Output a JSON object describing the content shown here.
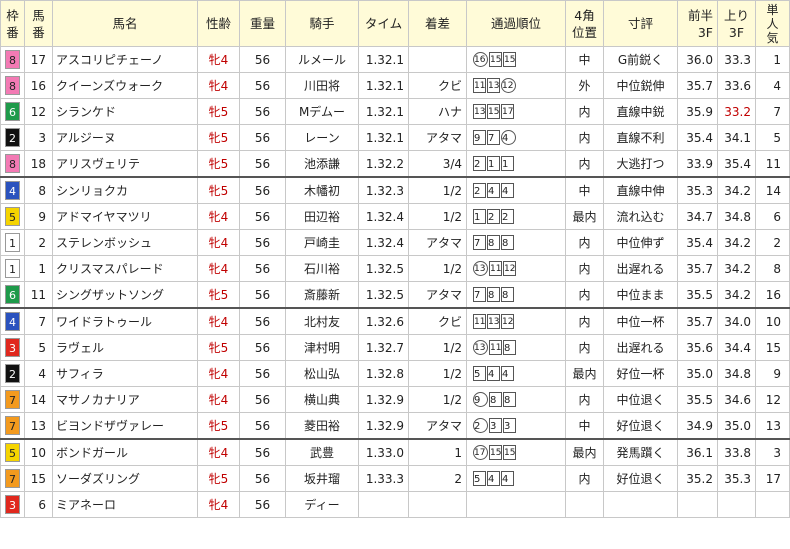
{
  "headers": {
    "waku": [
      "枠",
      "番"
    ],
    "umaban": [
      "馬",
      "番"
    ],
    "name": "馬名",
    "age": "性齢",
    "weight": "重量",
    "jockey": "騎手",
    "time": "タイム",
    "margin": "着差",
    "passing": "通過順位",
    "corner": [
      "4角",
      "位置"
    ],
    "comment": "寸評",
    "first3f": [
      "前半",
      "3F"
    ],
    "last3f": [
      "上り",
      "3F"
    ],
    "pop": [
      "単",
      "人",
      "気"
    ]
  },
  "waku_colors": {
    "1": {
      "bg": "#ffffff",
      "fg": "#222222"
    },
    "2": {
      "bg": "#111111",
      "fg": "#ffffff"
    },
    "3": {
      "bg": "#e0281e",
      "fg": "#ffffff"
    },
    "4": {
      "bg": "#2a52be",
      "fg": "#ffffff"
    },
    "5": {
      "bg": "#f5d400",
      "fg": "#222222"
    },
    "6": {
      "bg": "#1e9a4a",
      "fg": "#ffffff"
    },
    "7": {
      "bg": "#f39a1e",
      "fg": "#222222"
    },
    "8": {
      "bg": "#f37ab4",
      "fg": "#222222"
    }
  },
  "rows": [
    {
      "waku": "8",
      "umaban": "17",
      "name": "アスコリピチェーノ",
      "age": "牝4",
      "weight": "56",
      "jockey": "ルメール",
      "time": "1.32.1",
      "margin": "",
      "passing": [
        {
          "n": "16",
          "c": true
        },
        {
          "n": "15",
          "c": false
        },
        {
          "n": "15",
          "c": false
        }
      ],
      "corner": "中",
      "comment": "G前鋭く",
      "f3": "36.0",
      "l3": "33.3",
      "l3red": false,
      "pop": "1",
      "group_start": false
    },
    {
      "waku": "8",
      "umaban": "16",
      "name": "クイーンズウォーク",
      "age": "牝4",
      "weight": "56",
      "jockey": "川田将",
      "time": "1.32.1",
      "margin": "クビ",
      "passing": [
        {
          "n": "11",
          "c": false
        },
        {
          "n": "13",
          "c": false
        },
        {
          "n": "12",
          "c": true
        }
      ],
      "corner": "外",
      "comment": "中位鋭伸",
      "f3": "35.7",
      "l3": "33.6",
      "l3red": false,
      "pop": "4",
      "group_start": false
    },
    {
      "waku": "6",
      "umaban": "12",
      "name": "シランケド",
      "age": "牝5",
      "weight": "56",
      "jockey": "Mデムー",
      "time": "1.32.1",
      "margin": "ハナ",
      "passing": [
        {
          "n": "13",
          "c": false
        },
        {
          "n": "15",
          "c": false
        },
        {
          "n": "17",
          "c": false
        }
      ],
      "corner": "内",
      "comment": "直線中鋭",
      "f3": "35.9",
      "l3": "33.2",
      "l3red": true,
      "pop": "7",
      "group_start": false
    },
    {
      "waku": "2",
      "umaban": "3",
      "name": "アルジーヌ",
      "age": "牝5",
      "weight": "56",
      "jockey": "レーン",
      "time": "1.32.1",
      "margin": "アタマ",
      "passing": [
        {
          "n": "9",
          "c": false
        },
        {
          "n": "7",
          "c": false
        },
        {
          "n": "4",
          "c": true
        }
      ],
      "corner": "内",
      "comment": "直線不利",
      "f3": "35.4",
      "l3": "34.1",
      "l3red": false,
      "pop": "5",
      "group_start": false
    },
    {
      "waku": "8",
      "umaban": "18",
      "name": "アリスヴェリテ",
      "age": "牝5",
      "weight": "56",
      "jockey": "池添謙",
      "time": "1.32.2",
      "margin": "3/4",
      "passing": [
        {
          "n": "2",
          "c": false
        },
        {
          "n": "1",
          "c": false
        },
        {
          "n": "1",
          "c": false
        }
      ],
      "corner": "内",
      "comment": "大逃打つ",
      "f3": "33.9",
      "l3": "35.4",
      "l3red": false,
      "pop": "11",
      "group_start": false
    },
    {
      "waku": "4",
      "umaban": "8",
      "name": "シンリョクカ",
      "age": "牝5",
      "weight": "56",
      "jockey": "木幡初",
      "time": "1.32.3",
      "margin": "1/2",
      "passing": [
        {
          "n": "2",
          "c": false
        },
        {
          "n": "4",
          "c": false
        },
        {
          "n": "4",
          "c": false
        }
      ],
      "corner": "中",
      "comment": "直線中伸",
      "f3": "35.3",
      "l3": "34.2",
      "l3red": false,
      "pop": "14",
      "group_start": true
    },
    {
      "waku": "5",
      "umaban": "9",
      "name": "アドマイヤマツリ",
      "age": "牝4",
      "weight": "56",
      "jockey": "田辺裕",
      "time": "1.32.4",
      "margin": "1/2",
      "passing": [
        {
          "n": "1",
          "c": false
        },
        {
          "n": "2",
          "c": false
        },
        {
          "n": "2",
          "c": false
        }
      ],
      "corner": "最内",
      "comment": "流れ込む",
      "f3": "34.7",
      "l3": "34.8",
      "l3red": false,
      "pop": "6",
      "group_start": false
    },
    {
      "waku": "1",
      "umaban": "2",
      "name": "ステレンボッシュ",
      "age": "牝4",
      "weight": "56",
      "jockey": "戸崎圭",
      "time": "1.32.4",
      "margin": "アタマ",
      "passing": [
        {
          "n": "7",
          "c": false
        },
        {
          "n": "8",
          "c": false
        },
        {
          "n": "8",
          "c": false
        }
      ],
      "corner": "内",
      "comment": "中位伸ず",
      "f3": "35.4",
      "l3": "34.2",
      "l3red": false,
      "pop": "2",
      "group_start": false
    },
    {
      "waku": "1",
      "umaban": "1",
      "name": "クリスマスパレード",
      "age": "牝4",
      "weight": "56",
      "jockey": "石川裕",
      "time": "1.32.5",
      "margin": "1/2",
      "passing": [
        {
          "n": "13",
          "c": true
        },
        {
          "n": "11",
          "c": false
        },
        {
          "n": "12",
          "c": false
        }
      ],
      "corner": "内",
      "comment": "出遅れる",
      "f3": "35.7",
      "l3": "34.2",
      "l3red": false,
      "pop": "8",
      "group_start": false
    },
    {
      "waku": "6",
      "umaban": "11",
      "name": "シングザットソング",
      "age": "牝5",
      "weight": "56",
      "jockey": "斎藤新",
      "time": "1.32.5",
      "margin": "アタマ",
      "passing": [
        {
          "n": "7",
          "c": false
        },
        {
          "n": "8",
          "c": false
        },
        {
          "n": "8",
          "c": false
        }
      ],
      "corner": "内",
      "comment": "中位まま",
      "f3": "35.5",
      "l3": "34.2",
      "l3red": false,
      "pop": "16",
      "group_start": false
    },
    {
      "waku": "4",
      "umaban": "7",
      "name": "ワイドラトゥール",
      "age": "牝4",
      "weight": "56",
      "jockey": "北村友",
      "time": "1.32.6",
      "margin": "クビ",
      "passing": [
        {
          "n": "11",
          "c": false
        },
        {
          "n": "13",
          "c": false
        },
        {
          "n": "12",
          "c": false
        }
      ],
      "corner": "内",
      "comment": "中位一杯",
      "f3": "35.7",
      "l3": "34.0",
      "l3red": false,
      "pop": "10",
      "group_start": true
    },
    {
      "waku": "3",
      "umaban": "5",
      "name": "ラヴェル",
      "age": "牝5",
      "weight": "56",
      "jockey": "津村明",
      "time": "1.32.7",
      "margin": "1/2",
      "passing": [
        {
          "n": "13",
          "c": true
        },
        {
          "n": "11",
          "c": false
        },
        {
          "n": "8",
          "c": false
        }
      ],
      "corner": "内",
      "comment": "出遅れる",
      "f3": "35.6",
      "l3": "34.4",
      "l3red": false,
      "pop": "15",
      "group_start": false
    },
    {
      "waku": "2",
      "umaban": "4",
      "name": "サフィラ",
      "age": "牝4",
      "weight": "56",
      "jockey": "松山弘",
      "time": "1.32.8",
      "margin": "1/2",
      "passing": [
        {
          "n": "5",
          "c": false
        },
        {
          "n": "4",
          "c": false
        },
        {
          "n": "4",
          "c": false
        }
      ],
      "corner": "最内",
      "comment": "好位一杯",
      "f3": "35.0",
      "l3": "34.8",
      "l3red": false,
      "pop": "9",
      "group_start": false
    },
    {
      "waku": "7",
      "umaban": "14",
      "name": "マサノカナリア",
      "age": "牝4",
      "weight": "56",
      "jockey": "横山典",
      "time": "1.32.9",
      "margin": "1/2",
      "passing": [
        {
          "n": "9",
          "c": true
        },
        {
          "n": "8",
          "c": false
        },
        {
          "n": "8",
          "c": false
        }
      ],
      "corner": "内",
      "comment": "中位退く",
      "f3": "35.5",
      "l3": "34.6",
      "l3red": false,
      "pop": "12",
      "group_start": false
    },
    {
      "waku": "7",
      "umaban": "13",
      "name": "ビヨンドザヴァレー",
      "age": "牝5",
      "weight": "56",
      "jockey": "菱田裕",
      "time": "1.32.9",
      "margin": "アタマ",
      "passing": [
        {
          "n": "2",
          "c": true
        },
        {
          "n": "3",
          "c": false
        },
        {
          "n": "3",
          "c": false
        }
      ],
      "corner": "中",
      "comment": "好位退く",
      "f3": "34.9",
      "l3": "35.0",
      "l3red": false,
      "pop": "13",
      "group_start": false
    },
    {
      "waku": "5",
      "umaban": "10",
      "name": "ボンドガール",
      "age": "牝4",
      "weight": "56",
      "jockey": "武豊",
      "time": "1.33.0",
      "margin": "1",
      "passing": [
        {
          "n": "17",
          "c": true
        },
        {
          "n": "15",
          "c": false
        },
        {
          "n": "15",
          "c": false
        }
      ],
      "corner": "最内",
      "comment": "発馬躓く",
      "f3": "36.1",
      "l3": "33.8",
      "l3red": false,
      "pop": "3",
      "group_start": true
    },
    {
      "waku": "7",
      "umaban": "15",
      "name": "ソーダズリング",
      "age": "牝5",
      "weight": "56",
      "jockey": "坂井瑠",
      "time": "1.33.3",
      "margin": "2",
      "passing": [
        {
          "n": "5",
          "c": false
        },
        {
          "n": "4",
          "c": false
        },
        {
          "n": "4",
          "c": false
        }
      ],
      "corner": "内",
      "comment": "好位退く",
      "f3": "35.2",
      "l3": "35.3",
      "l3red": false,
      "pop": "17",
      "group_start": false
    },
    {
      "waku": "3",
      "umaban": "6",
      "name": "ミアネーロ",
      "age": "牝4",
      "weight": "56",
      "jockey": "ディー",
      "time": "",
      "margin": "",
      "passing": [],
      "corner": "",
      "comment": "",
      "f3": "",
      "l3": "",
      "l3red": false,
      "pop": "",
      "group_start": false
    }
  ]
}
